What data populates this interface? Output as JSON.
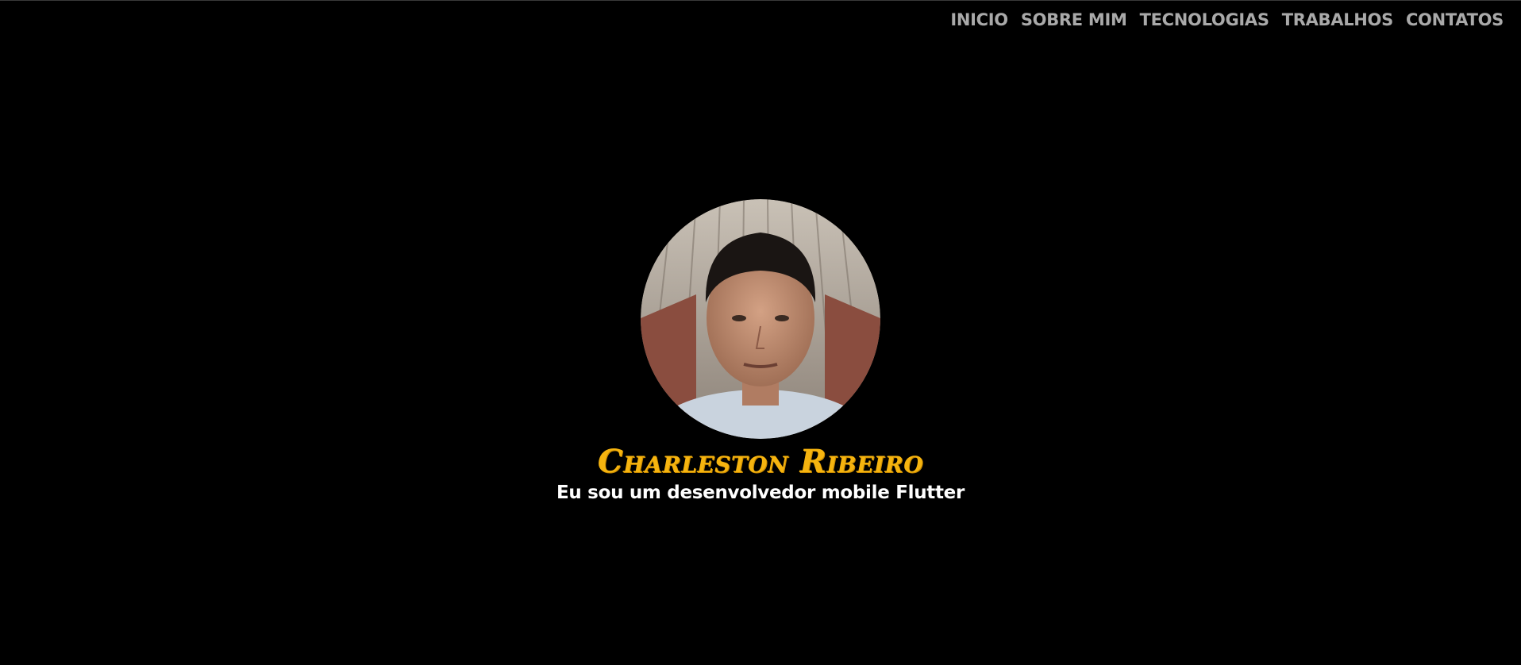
{
  "nav": {
    "items": [
      {
        "label": "INICIO"
      },
      {
        "label": "SOBRE MIM"
      },
      {
        "label": "TECNOLOGIAS"
      },
      {
        "label": "TRABALHOS"
      },
      {
        "label": "CONTATOS"
      }
    ]
  },
  "hero": {
    "name": "Charleston Ribeiro",
    "tagline": "Eu sou um desenvolvedor mobile Flutter"
  },
  "colors": {
    "background": "#000000",
    "nav_text": "#a9a9a9",
    "name_accent": "#f6b40f",
    "tagline_text": "#ffffff"
  }
}
